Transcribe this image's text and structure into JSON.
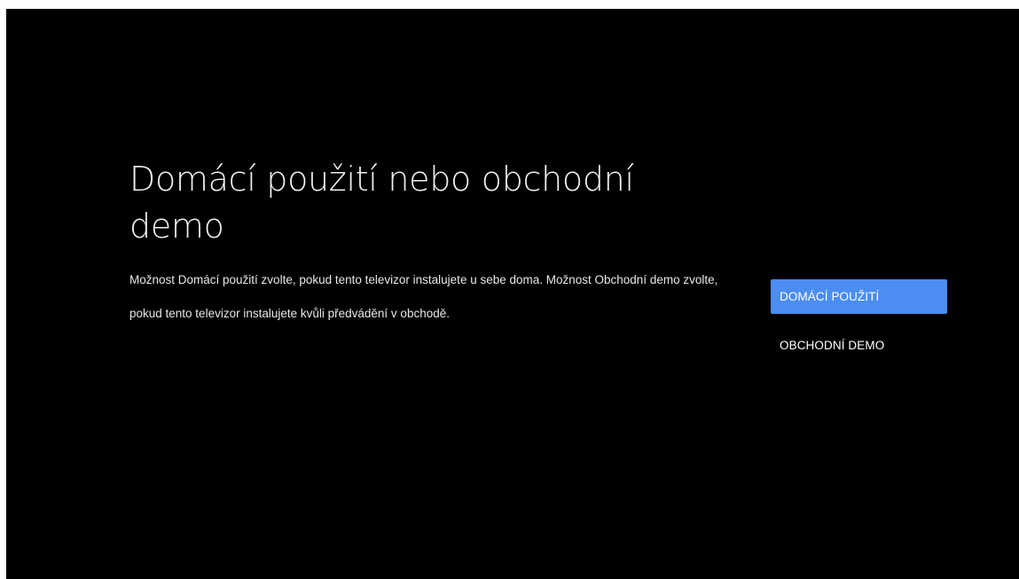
{
  "screen": {
    "title": "Domácí použití nebo obchodní demo",
    "description": "Možnost Domácí použití zvolte, pokud tento televizor instalujete u sebe doma. Možnost Obchodní demo zvolte, pokud tento televizor instalujete kvůli předvádění v obchodě."
  },
  "options": [
    {
      "label": "DOMÁCÍ POUŽITÍ",
      "selected": true
    },
    {
      "label": "OBCHODNÍ DEMO",
      "selected": false
    }
  ],
  "colors": {
    "background": "#000000",
    "accent": "#4b8df1",
    "text": "#ffffff"
  }
}
